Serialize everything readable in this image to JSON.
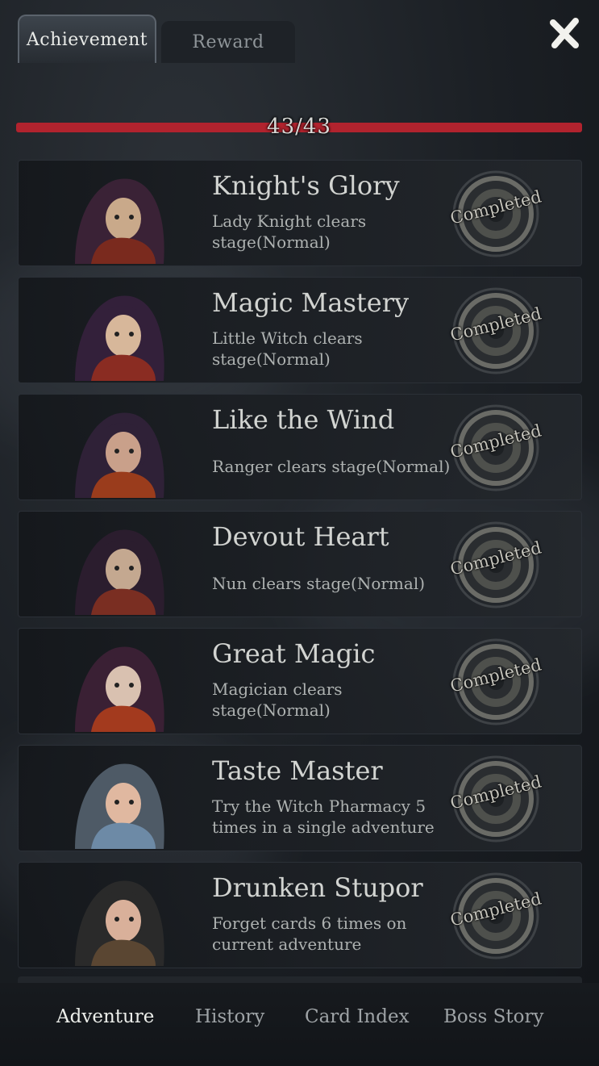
{
  "tabs": [
    {
      "label": "Achievement",
      "active": true
    },
    {
      "label": "Reward",
      "active": false
    }
  ],
  "progress": {
    "text": "43/43",
    "current": 43,
    "total": 43
  },
  "badge_label": "Completed",
  "achievements": [
    {
      "title": "Knight's Glory",
      "description": "Lady Knight clears stage(Normal)",
      "character": "lady-knight",
      "status": "Completed"
    },
    {
      "title": "Magic Mastery",
      "description": "Little Witch clears stage(Normal)",
      "character": "little-witch",
      "status": "Completed"
    },
    {
      "title": "Like the Wind",
      "description": "Ranger clears stage(Normal)",
      "character": "ranger",
      "status": "Completed"
    },
    {
      "title": "Devout Heart",
      "description": "Nun clears stage(Normal)",
      "character": "nun",
      "status": "Completed"
    },
    {
      "title": "Great Magic",
      "description": "Magician clears stage(Normal)",
      "character": "magician",
      "status": "Completed"
    },
    {
      "title": "Taste Master",
      "description": "Try the Witch Pharmacy 5 times in a single adventure",
      "character": "chef",
      "status": "Completed"
    },
    {
      "title": "Drunken Stupor",
      "description": "Forget cards 6 times on current adventure",
      "character": "drunkard",
      "status": "Completed"
    }
  ],
  "bottom_nav": [
    {
      "label": "Adventure",
      "active": true
    },
    {
      "label": "History",
      "active": false
    },
    {
      "label": "Card Index",
      "active": false
    },
    {
      "label": "Boss Story",
      "active": false
    }
  ],
  "colors": {
    "progress_fill": "#b1232e",
    "text": "#d2d4d1",
    "background": "#1b1f24"
  }
}
